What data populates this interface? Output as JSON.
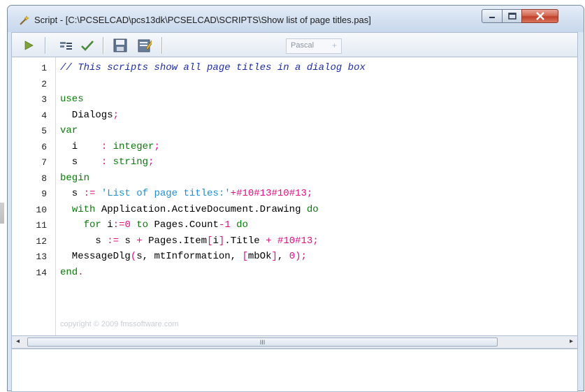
{
  "window": {
    "title": "Script - [C:\\PCSELCAD\\pcs13dk\\PCSELCAD\\SCRIPTS\\Show list of page titles.pas]",
    "app_icon": "script-wand-icon",
    "controls": {
      "minimize": "minimize-icon",
      "maximize": "maximize-icon",
      "close": "close-icon"
    }
  },
  "toolbar": {
    "buttons": [
      "run-icon",
      "syntax-check-icon",
      "checkmark-icon",
      "save-icon",
      "edit-icon"
    ],
    "language": "Pascal"
  },
  "editor": {
    "line_numbers": [
      "1",
      "2",
      "3",
      "4",
      "5",
      "6",
      "7",
      "8",
      "9",
      "10",
      "11",
      "12",
      "13",
      "14"
    ],
    "lines": [
      [
        {
          "t": "comment",
          "s": "// This scripts show all page titles in a dialog box"
        }
      ],
      [],
      [
        {
          "t": "kw",
          "s": "uses"
        }
      ],
      [
        {
          "t": "txt",
          "s": "  Dialogs"
        },
        {
          "t": "op",
          "s": ";"
        }
      ],
      [
        {
          "t": "kw",
          "s": "var"
        }
      ],
      [
        {
          "t": "txt",
          "s": "  i    "
        },
        {
          "t": "op",
          "s": ": "
        },
        {
          "t": "kw",
          "s": "integer"
        },
        {
          "t": "op",
          "s": ";"
        }
      ],
      [
        {
          "t": "txt",
          "s": "  s    "
        },
        {
          "t": "op",
          "s": ": "
        },
        {
          "t": "kw",
          "s": "string"
        },
        {
          "t": "op",
          "s": ";"
        }
      ],
      [
        {
          "t": "kw",
          "s": "begin"
        }
      ],
      [
        {
          "t": "txt",
          "s": "  s "
        },
        {
          "t": "op",
          "s": ":= "
        },
        {
          "t": "str",
          "s": "'List of page titles:'"
        },
        {
          "t": "op",
          "s": "+"
        },
        {
          "t": "num",
          "s": "#10#13#10#13"
        },
        {
          "t": "op",
          "s": ";"
        }
      ],
      [
        {
          "t": "txt",
          "s": "  "
        },
        {
          "t": "kw",
          "s": "with"
        },
        {
          "t": "txt",
          "s": " Application.ActiveDocument.Drawing "
        },
        {
          "t": "kw",
          "s": "do"
        }
      ],
      [
        {
          "t": "txt",
          "s": "    "
        },
        {
          "t": "kw",
          "s": "for"
        },
        {
          "t": "txt",
          "s": " i"
        },
        {
          "t": "op",
          "s": ":="
        },
        {
          "t": "num",
          "s": "0"
        },
        {
          "t": "txt",
          "s": " "
        },
        {
          "t": "kw",
          "s": "to"
        },
        {
          "t": "txt",
          "s": " Pages.Count"
        },
        {
          "t": "op",
          "s": "-"
        },
        {
          "t": "num",
          "s": "1"
        },
        {
          "t": "txt",
          "s": " "
        },
        {
          "t": "kw",
          "s": "do"
        }
      ],
      [
        {
          "t": "txt",
          "s": "      s "
        },
        {
          "t": "op",
          "s": ":= "
        },
        {
          "t": "txt",
          "s": "s "
        },
        {
          "t": "op",
          "s": "+ "
        },
        {
          "t": "txt",
          "s": "Pages.Item"
        },
        {
          "t": "op",
          "s": "["
        },
        {
          "t": "txt",
          "s": "i"
        },
        {
          "t": "op",
          "s": "]"
        },
        {
          "t": "txt",
          "s": ".Title "
        },
        {
          "t": "op",
          "s": "+ "
        },
        {
          "t": "num",
          "s": "#10#13"
        },
        {
          "t": "op",
          "s": ";"
        }
      ],
      [
        {
          "t": "txt",
          "s": "  MessageDlg"
        },
        {
          "t": "op",
          "s": "("
        },
        {
          "t": "txt",
          "s": "s, mtInformation, "
        },
        {
          "t": "op",
          "s": "["
        },
        {
          "t": "txt",
          "s": "mbOk"
        },
        {
          "t": "op",
          "s": "]"
        },
        {
          "t": "txt",
          "s": ", "
        },
        {
          "t": "num",
          "s": "0"
        },
        {
          "t": "op",
          "s": ");"
        }
      ],
      [
        {
          "t": "kw",
          "s": "end"
        },
        {
          "t": "op",
          "s": "."
        }
      ]
    ],
    "copyright": "copyright © 2009 fmssoftware.com"
  },
  "scrollbar": {
    "grip": "III",
    "left_arrow": "◂",
    "right_arrow": "▸"
  },
  "colors": {
    "comment": "#1f2fa8",
    "keyword": "#0b7a0b",
    "operator": "#e0107e",
    "string": "#1f8fd0"
  }
}
